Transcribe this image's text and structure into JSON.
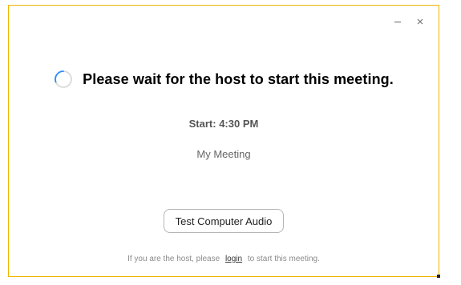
{
  "window": {
    "accent_color": "#f0b400",
    "controls": {
      "minimize_icon": "minimize-icon",
      "close_icon": "close-icon"
    }
  },
  "main": {
    "spinner_icon": "loading-spinner-icon",
    "heading": "Please wait for the host to start this meeting.",
    "start_time": "Start: 4:30 PM",
    "meeting_name": "My Meeting",
    "test_audio_label": "Test Computer Audio"
  },
  "footer": {
    "prefix": "If you are the host, please",
    "login_label": "login",
    "suffix": "to start this meeting."
  }
}
